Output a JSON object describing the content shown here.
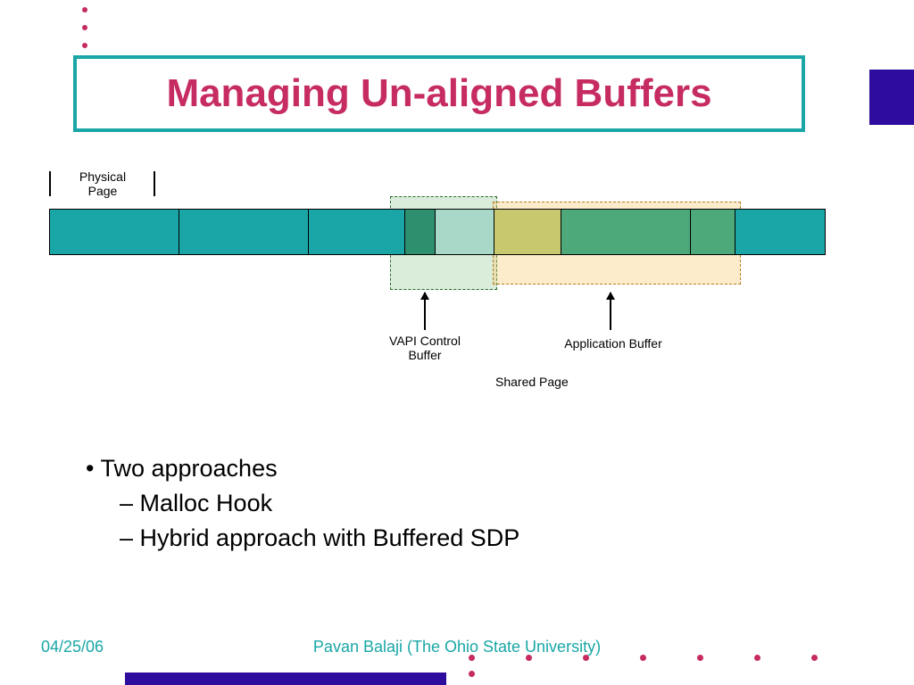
{
  "title": "Managing Un-aligned Buffers",
  "diagram": {
    "physical_page": "Physical\nPage",
    "vapi": "VAPI Control Buffer",
    "app": "Application Buffer",
    "shared": "Shared Page"
  },
  "bullets": {
    "main": "Two approaches",
    "sub1": "Malloc Hook",
    "sub2": "Hybrid approach with Buffered SDP"
  },
  "footer": {
    "date": "04/25/06",
    "author": "Pavan Balaji (The Ohio State University)"
  }
}
